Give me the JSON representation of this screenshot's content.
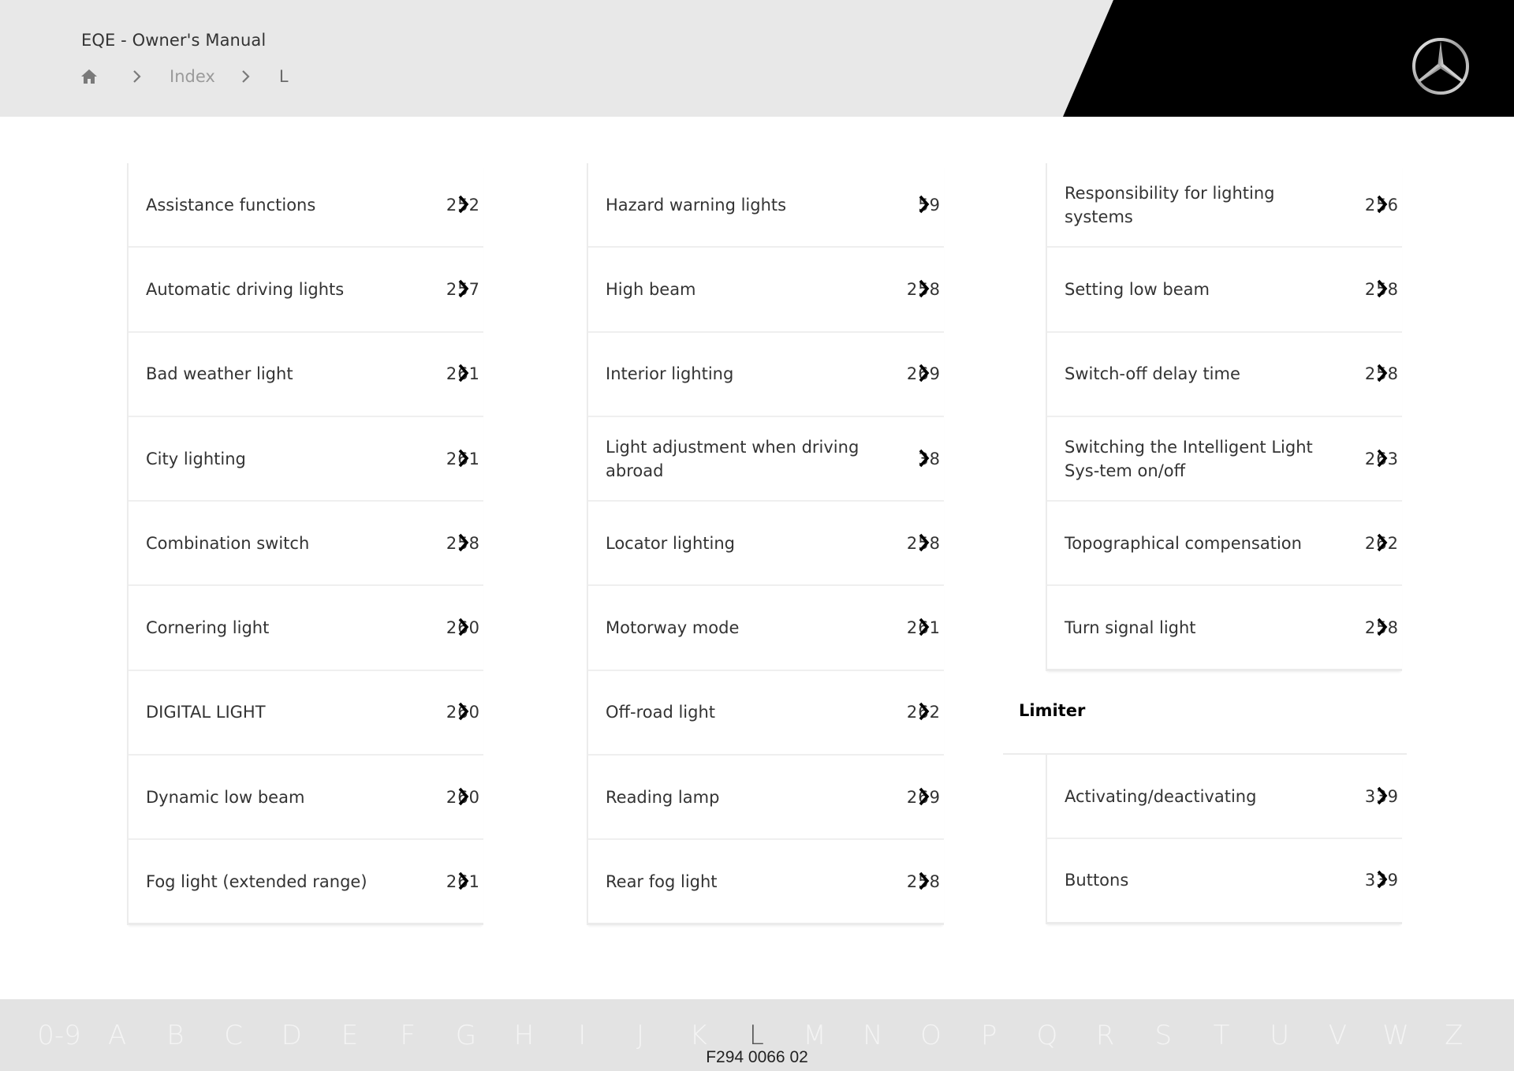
{
  "header": {
    "title": "EQE - Owner's Manual",
    "breadcrumb": {
      "home_icon": "home-icon",
      "separator_icon": "chevron-right-icon",
      "items": [
        "Index",
        "L"
      ]
    },
    "logo": "mercedes-star-logo",
    "colors": {
      "header_bg": "#e8e8e8",
      "brand_block": "#000000"
    }
  },
  "columns": [
    {
      "rows": [
        {
          "label": "Assistance functions",
          "page": "252"
        },
        {
          "label": "Automatic driving lights",
          "page": "257"
        },
        {
          "label": "Bad weather light",
          "page": "261"
        },
        {
          "label": "City lighting",
          "page": "261"
        },
        {
          "label": "Combination switch",
          "page": "258"
        },
        {
          "label": "Cornering light",
          "page": "260"
        },
        {
          "label": "DIGITAL LIGHT",
          "page": "260"
        },
        {
          "label": "Dynamic low beam",
          "page": "260"
        },
        {
          "label": "Fog light (extended range)",
          "page": "261"
        }
      ]
    },
    {
      "rows": [
        {
          "label": "Hazard warning lights",
          "page": "59"
        },
        {
          "label": "High beam",
          "page": "258"
        },
        {
          "label": "Interior lighting",
          "page": "269"
        },
        {
          "label": "Light adjustment when driving abroad",
          "page": "38"
        },
        {
          "label": "Locator lighting",
          "page": "258"
        },
        {
          "label": "Motorway mode",
          "page": "261"
        },
        {
          "label": "Off-road light",
          "page": "262"
        },
        {
          "label": "Reading lamp",
          "page": "269"
        },
        {
          "label": "Rear fog light",
          "page": "258"
        }
      ]
    },
    {
      "rows": [
        {
          "label": "Responsibility for lighting systems",
          "page": "256"
        },
        {
          "label": "Setting low beam",
          "page": "258"
        },
        {
          "label": "Switch-off delay time",
          "page": "258"
        },
        {
          "label": "Switching the Intelligent Light Sys-tem on/off",
          "page": "263"
        },
        {
          "label": "Topographical compensation",
          "page": "262"
        },
        {
          "label": "Turn signal light",
          "page": "258"
        }
      ],
      "subsection": {
        "heading": "Limiter",
        "rows": [
          {
            "label": "Activating/deactivating",
            "page": "339"
          },
          {
            "label": "Buttons",
            "page": "339"
          }
        ]
      }
    }
  ],
  "row_icon": "chevron-right-icon",
  "alphabet_nav": {
    "letters": [
      "0-9",
      "A",
      "B",
      "C",
      "D",
      "E",
      "F",
      "G",
      "H",
      "I",
      "J",
      "K",
      "L",
      "M",
      "N",
      "O",
      "P",
      "Q",
      "R",
      "S",
      "T",
      "U",
      "V",
      "W",
      "Z"
    ],
    "active": "L"
  },
  "doc_code": "F294 0066 02"
}
